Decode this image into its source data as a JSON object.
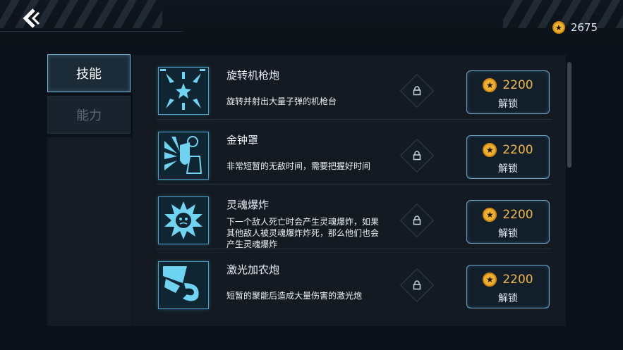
{
  "header": {
    "coins": "2675"
  },
  "tabs": [
    {
      "label": "技能",
      "active": true
    },
    {
      "label": "能力",
      "active": false
    }
  ],
  "skills": [
    {
      "name": "旋转机枪炮",
      "desc": "旋转并射出大量子弹的机枪台",
      "price": "2200",
      "action": "解锁",
      "icon": "turret-icon"
    },
    {
      "name": "金钟罩",
      "desc": "非常短暂的无敌时间，需要把握好时间",
      "price": "2200",
      "action": "解锁",
      "icon": "shield-icon"
    },
    {
      "name": "灵魂爆炸",
      "desc": "下一个敌人死亡时会产生灵魂爆炸，如果其他敌人被灵魂爆炸炸死，那么他们也会产生灵魂爆炸",
      "price": "2200",
      "action": "解锁",
      "icon": "soul-explosion-icon"
    },
    {
      "name": "激光加农炮",
      "desc": "短暂的聚能后造成大量伤害的激光炮",
      "price": "2200",
      "action": "解锁",
      "icon": "laser-cannon-icon"
    }
  ],
  "colors": {
    "accent": "#6fb9d8",
    "coin": "#f0b030",
    "price": "#f0b848"
  }
}
